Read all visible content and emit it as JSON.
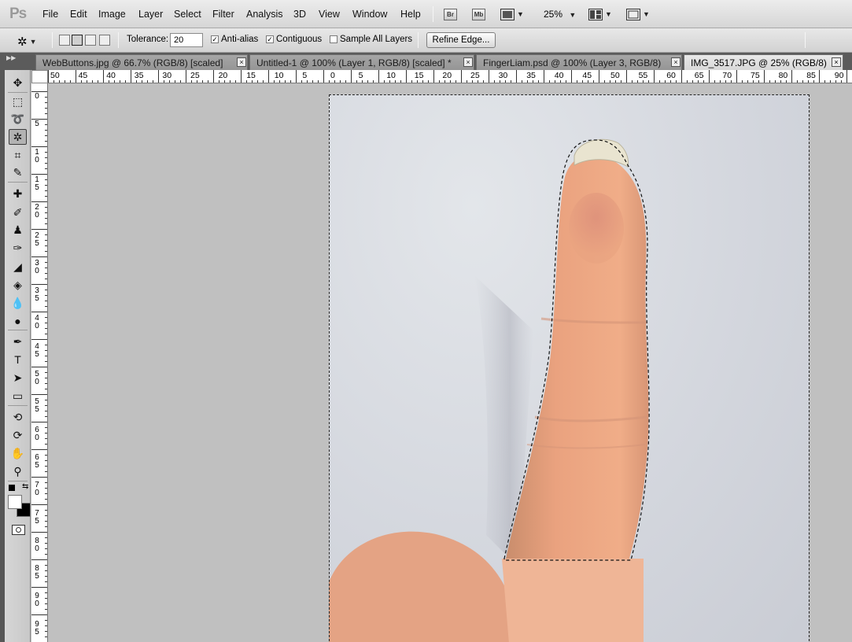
{
  "app": {
    "logo": "Ps",
    "menu": [
      "File",
      "Edit",
      "Image",
      "Layer",
      "Select",
      "Filter",
      "Analysis",
      "3D",
      "View",
      "Window",
      "Help"
    ],
    "bridge_label": "Br",
    "minibridge_label": "Mb",
    "zoom": "25%"
  },
  "options": {
    "tolerance_label": "Tolerance:",
    "tolerance_value": "20",
    "antialias_label": "Anti-alias",
    "antialias_checked": true,
    "contiguous_label": "Contiguous",
    "contiguous_checked": true,
    "sample_all_layers_label": "Sample All Layers",
    "sample_all_layers_checked": false,
    "refine_edge_label": "Refine Edge..."
  },
  "tabs": [
    {
      "label": "WebButtons.jpg @ 66.7% (RGB/8) [scaled]",
      "active": false
    },
    {
      "label": "Untitled-1 @ 100% (Layer 1, RGB/8) [scaled] *",
      "active": false
    },
    {
      "label": "FingerLiam.psd @ 100% (Layer 3, RGB/8)",
      "active": false
    },
    {
      "label": "IMG_3517.JPG @ 25% (RGB/8)",
      "active": true
    }
  ],
  "ruler": {
    "top_labels": [
      "50",
      "45",
      "40",
      "35",
      "30",
      "25",
      "20",
      "15",
      "10",
      "5",
      "0",
      "5",
      "10",
      "15",
      "20",
      "25",
      "30",
      "35",
      "40",
      "45",
      "50",
      "55",
      "60",
      "65",
      "70",
      "75",
      "80",
      "85",
      "90"
    ],
    "left_labels": [
      "0",
      "5",
      "10",
      "15",
      "20",
      "25",
      "30",
      "35",
      "40",
      "45",
      "50",
      "55",
      "60",
      "65",
      "70",
      "75",
      "80",
      "85",
      "90",
      "95"
    ]
  },
  "colors": {
    "accent": "#5b5b5b",
    "canvas_bg": "#c0c0c0",
    "skin": "#e8a27e"
  }
}
